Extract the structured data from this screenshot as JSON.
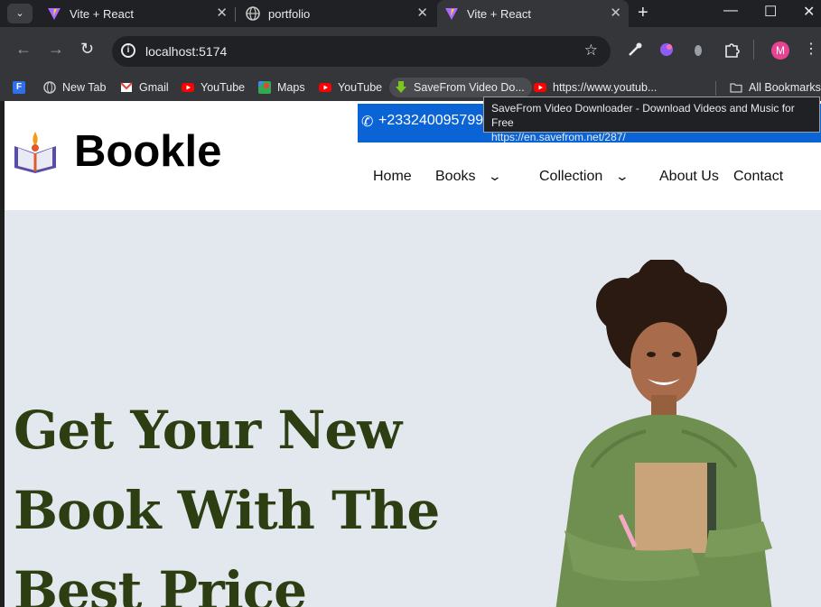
{
  "browser": {
    "tabs": [
      {
        "title": "Vite + React",
        "active": false
      },
      {
        "title": "portfolio",
        "active": false
      },
      {
        "title": "Vite + React",
        "active": true
      }
    ],
    "url": "localhost:5174",
    "bookmarks": [
      {
        "label": "New Tab"
      },
      {
        "label": "Gmail"
      },
      {
        "label": "YouTube"
      },
      {
        "label": "Maps"
      },
      {
        "label": "YouTube"
      },
      {
        "label": "SaveFrom Video Do..."
      },
      {
        "label": "https://www.youtub..."
      }
    ],
    "all_bookmarks": "All Bookmarks",
    "profile_initial": "M",
    "tooltip": {
      "line1": "SaveFrom Video Downloader - Download Videos and Music for Free",
      "line2": "https://en.savefrom.net/287/"
    }
  },
  "site": {
    "brand": "Bookle",
    "phone": "+233240095799",
    "nav": {
      "home": "Home",
      "books": "Books",
      "collection": "Collection",
      "about": "About Us",
      "contact": "Contact"
    },
    "hero": {
      "line1": "Get Your New",
      "line2": "Book With The",
      "line3": "Best Price"
    }
  },
  "colors": {
    "accent_bar": "#0b64d6",
    "hero_bg": "#e3e8ee",
    "hero_text": "#2c3e12"
  }
}
